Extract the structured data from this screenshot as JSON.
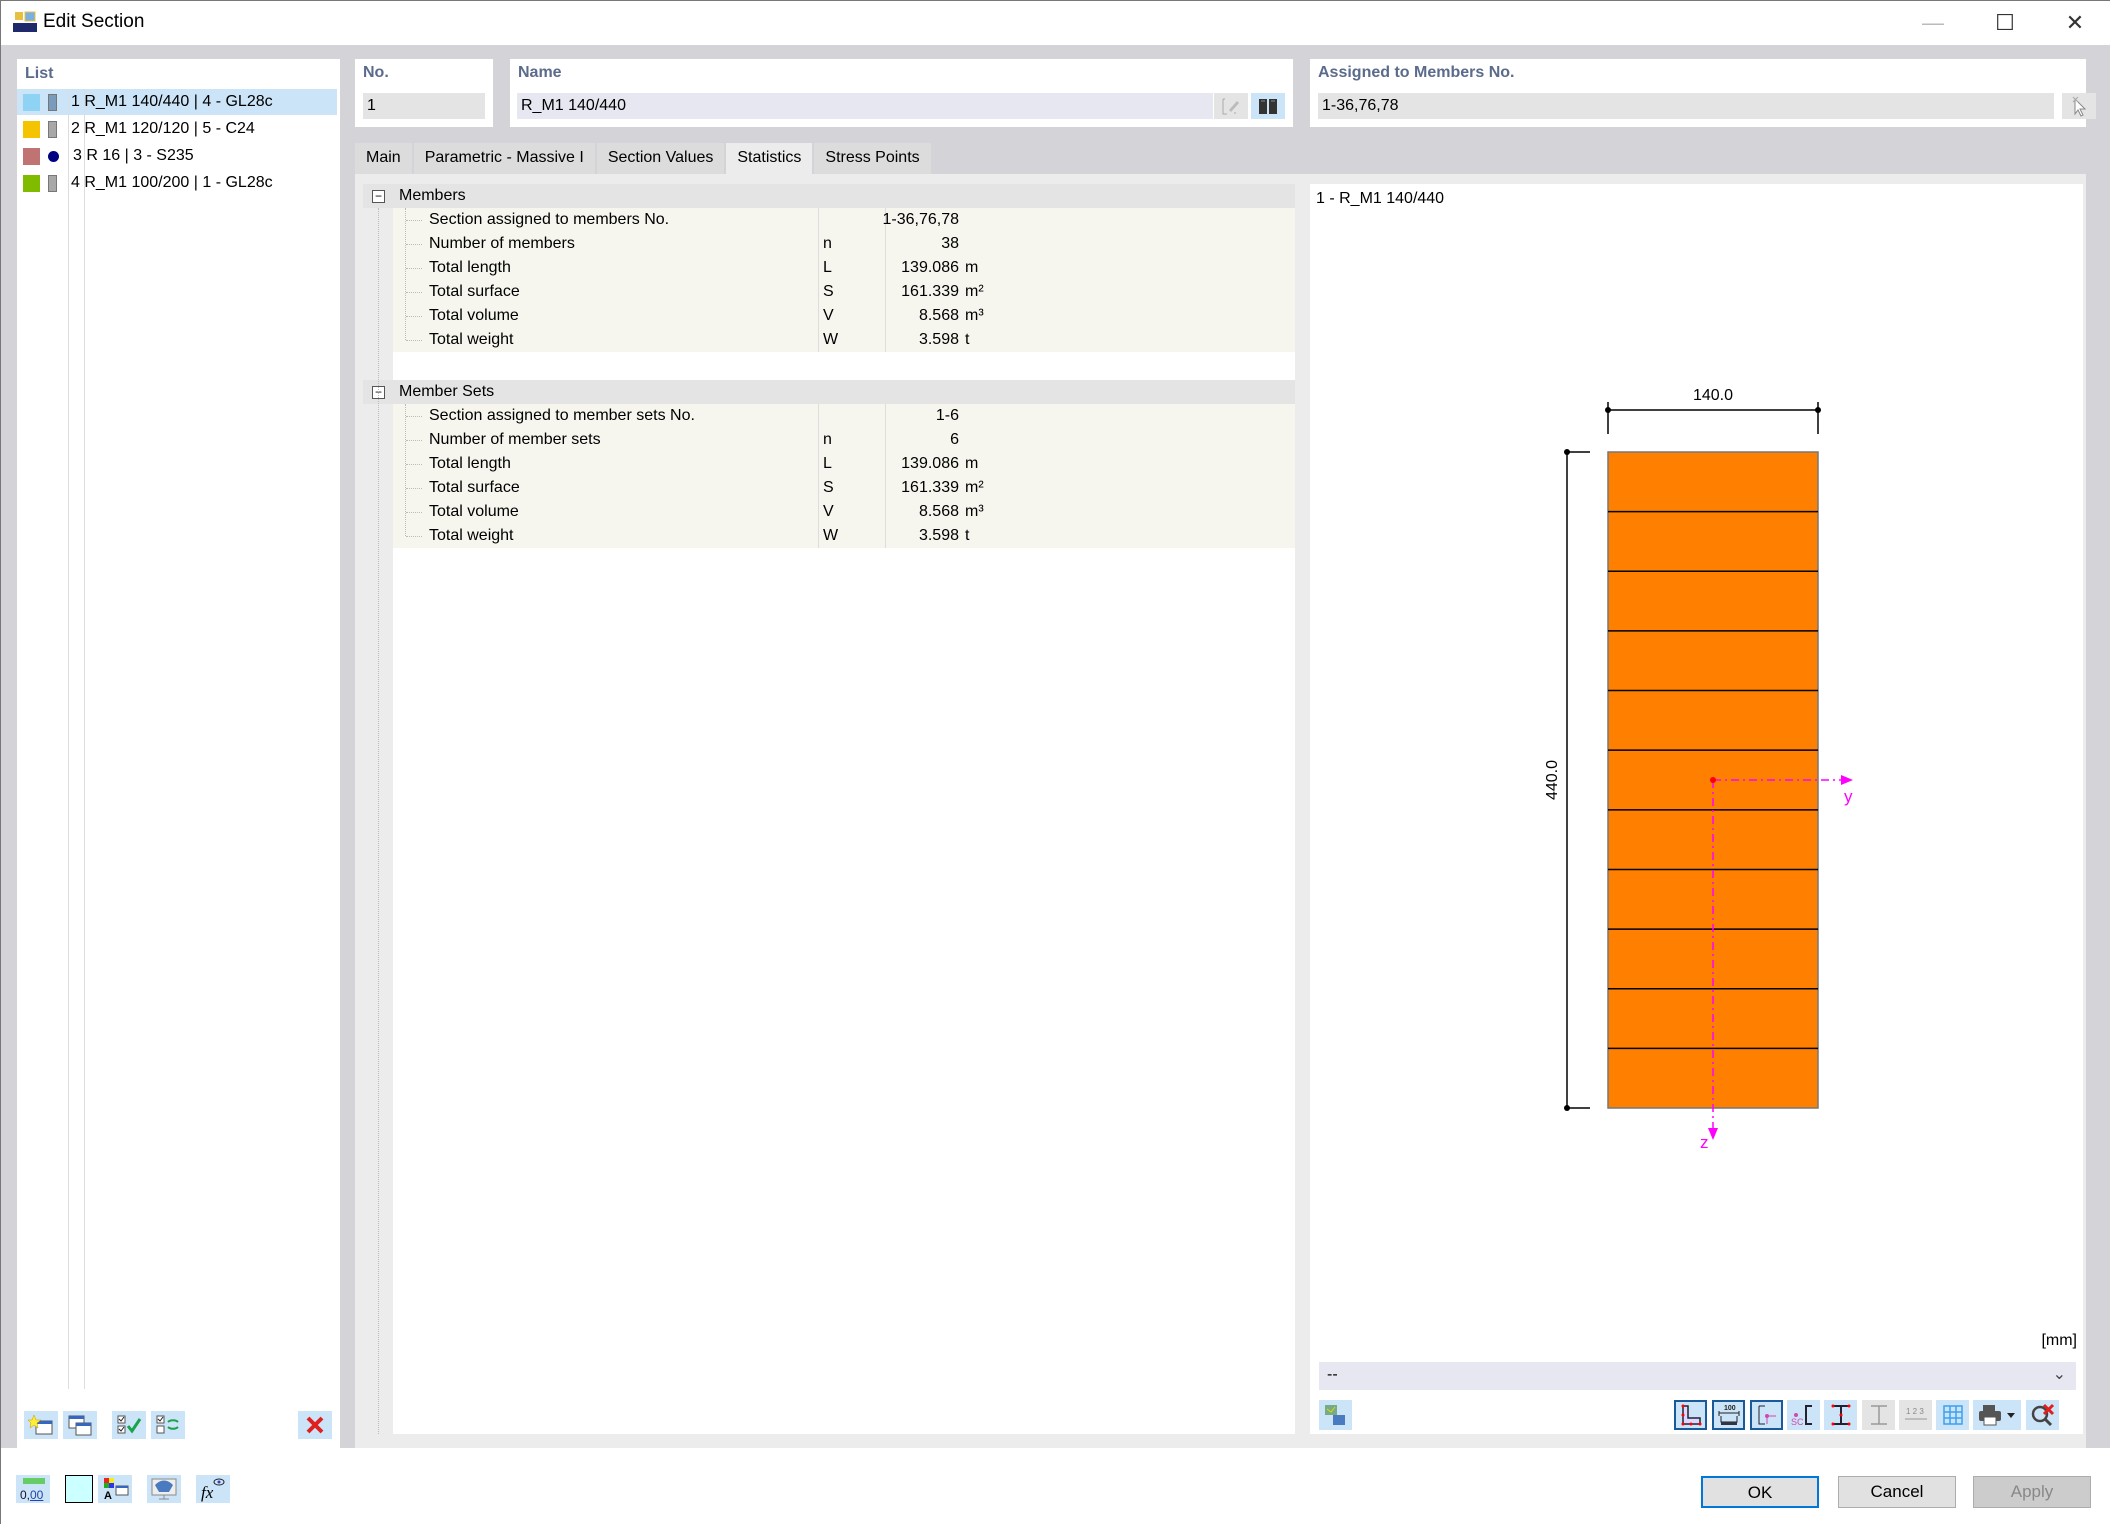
{
  "window": {
    "title": "Edit Section",
    "controls": {
      "minimize": "—",
      "maximize": "☐",
      "close": "✕"
    }
  },
  "list": {
    "title": "List",
    "items": [
      {
        "no": "1",
        "label": "1 R_M1 140/440 | 4 - GL28c",
        "color": "#8fd3f4",
        "shape": "rect",
        "selected": true
      },
      {
        "no": "2",
        "label": "2 R_M1 120/120 | 5 - C24",
        "color": "#f5c400",
        "shape": "rect",
        "selected": false
      },
      {
        "no": "3",
        "label": "3 R 16 | 3 - S235",
        "color": "#bf7373",
        "shape": "circle",
        "selected": false
      },
      {
        "no": "4",
        "label": "4 R_M1 100/200 | 1 - GL28c",
        "color": "#80bb00",
        "shape": "rect",
        "selected": false
      }
    ],
    "toolbar": {
      "new": "new-section-icon",
      "copy": "copy-section-icon",
      "check_all": "check-all-icon",
      "toggle": "toggle-selection-icon",
      "delete": "delete-icon"
    }
  },
  "header": {
    "no_label": "No.",
    "no_value": "1",
    "name_label": "Name",
    "name_value": "R_M1 140/440",
    "assigned_label": "Assigned to Members No.",
    "assigned_value": "1-36,76,78"
  },
  "tabs": [
    {
      "label": "Main",
      "active": false
    },
    {
      "label": "Parametric - Massive I",
      "active": false
    },
    {
      "label": "Section Values",
      "active": false
    },
    {
      "label": "Statistics",
      "active": true
    },
    {
      "label": "Stress Points",
      "active": false
    }
  ],
  "statistics": {
    "groups": [
      {
        "title": "Members",
        "rows": [
          {
            "label": "Section assigned to members No.",
            "symbol": "",
            "value": "1-36,76,78",
            "unit": ""
          },
          {
            "label": "Number of members",
            "symbol": "n",
            "value": "38",
            "unit": ""
          },
          {
            "label": "Total length",
            "symbol": "L",
            "value": "139.086",
            "unit": "m"
          },
          {
            "label": "Total surface",
            "symbol": "S",
            "value": "161.339",
            "unit": "m²"
          },
          {
            "label": "Total volume",
            "symbol": "V",
            "value": "8.568",
            "unit": "m³"
          },
          {
            "label": "Total weight",
            "symbol": "W",
            "value": "3.598",
            "unit": "t"
          }
        ]
      },
      {
        "title": "Member Sets",
        "rows": [
          {
            "label": "Section assigned to member sets No.",
            "symbol": "",
            "value": "1-6",
            "unit": ""
          },
          {
            "label": "Number of member sets",
            "symbol": "n",
            "value": "6",
            "unit": ""
          },
          {
            "label": "Total length",
            "symbol": "L",
            "value": "139.086",
            "unit": "m"
          },
          {
            "label": "Total surface",
            "symbol": "S",
            "value": "161.339",
            "unit": "m²"
          },
          {
            "label": "Total volume",
            "symbol": "V",
            "value": "8.568",
            "unit": "m³"
          },
          {
            "label": "Total weight",
            "symbol": "W",
            "value": "3.598",
            "unit": "t"
          }
        ]
      }
    ]
  },
  "preview": {
    "title": "1 - R_M1 140/440",
    "width_dim": "140.0",
    "height_dim": "440.0",
    "laminations": 11,
    "axis_y": "y",
    "axis_z": "z",
    "fill_color": "#ff8000",
    "axis_color": "#ff00ff",
    "units": "[mm]",
    "view_select": "--"
  },
  "footer": {
    "ok": "OK",
    "cancel": "Cancel",
    "apply": "Apply",
    "swatch_color": "#ccffff"
  }
}
